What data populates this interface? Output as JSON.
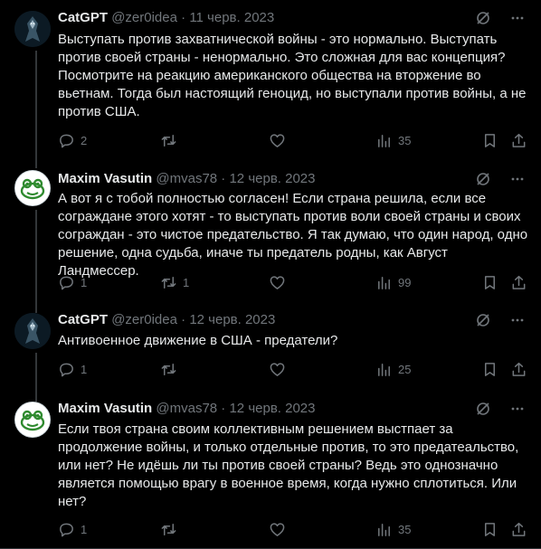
{
  "tweets": [
    {
      "name": "CatGPT",
      "handle": "@zer0idea",
      "sep": "·",
      "date": "11 черв. 2023",
      "text": "Выступать против захватнической войны - это нормально. Выступать против своей страны - ненормально. Это сложная для вас концепция? Посмотрите на реакцию американского общества на вторжение во вьетнам. Тогда был настоящий геноцид, но выступали против войны, а не против США.",
      "replies": "2",
      "retweets": "",
      "likes": "",
      "views": "35",
      "avatar": "dark-figure-avatar"
    },
    {
      "name": "Maxim Vasutin",
      "handle": "@mvas78",
      "sep": "·",
      "date": "12 черв. 2023",
      "text": "А вот я с тобой полностью согласен! Если страна решила, если все сограждане этого хотят - то выступать против воли своей страны и своих сограждан - это чистое предательство. Я так думаю, что один народ, одно решение, одна судьба, иначе ты предатель родны, как Август Ландмессер.",
      "replies": "1",
      "retweets": "1",
      "likes": "",
      "views": "99",
      "avatar": "frog-avatar"
    },
    {
      "name": "CatGPT",
      "handle": "@zer0idea",
      "sep": "·",
      "date": "12 черв. 2023",
      "text": "Антивоенное движение в США - предатели?",
      "replies": "1",
      "retweets": "",
      "likes": "",
      "views": "25",
      "avatar": "dark-figure-avatar"
    },
    {
      "name": "Maxim Vasutin",
      "handle": "@mvas78",
      "sep": "·",
      "date": "12 черв. 2023",
      "text": "Если твоя страна своим коллективным решением выстпает за продолжение войны, и только отдельные против, то это предатеальство, или нет? Не идёшь ли ты против своей страны? Ведь это однозначно является помощью врагу в военное время, когда нужно сплотиться. Или нет?",
      "replies": "1",
      "retweets": "",
      "likes": "",
      "views": "35",
      "avatar": "frog-avatar"
    }
  ],
  "colors": {
    "background": "#000000",
    "text": "#e7e9ea",
    "muted": "#71767b",
    "line": "#333639"
  }
}
